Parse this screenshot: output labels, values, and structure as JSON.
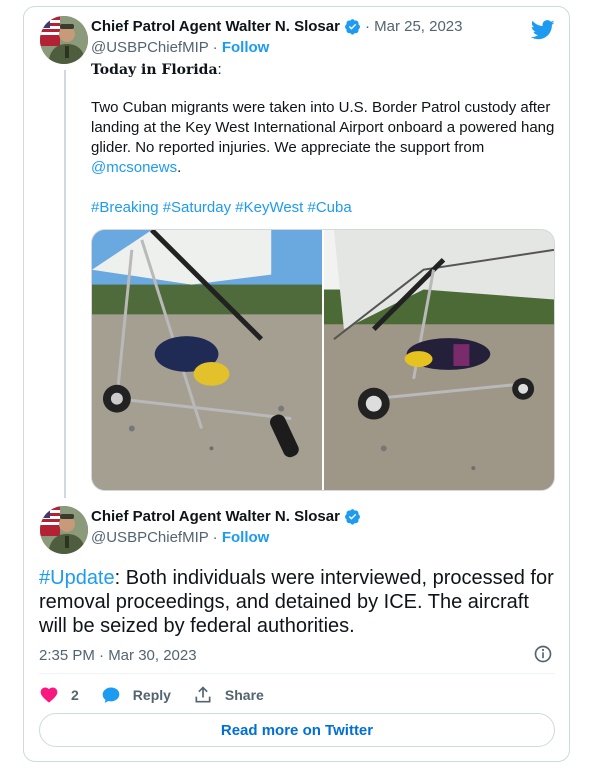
{
  "tweet1": {
    "author_name": "Chief Patrol Agent Walter N. Slosar",
    "handle": "@USBPChiefMIP",
    "separator": "·",
    "follow_label": "Follow",
    "date": "· Mar 25, 2023",
    "heading": "Today in Florida",
    "heading_suffix": ":",
    "body": "Two Cuban migrants were taken into U.S. Border Patrol custody after landing at the Key West International Airport onboard a powered hang glider. No reported injuries. We appreciate the support from ",
    "mention": "@mcsonews",
    "body_end": ".",
    "hashtags": "#Breaking #Saturday #KeyWest #Cuba"
  },
  "tweet2": {
    "author_name": "Chief Patrol Agent Walter N. Slosar",
    "handle": "@USBPChiefMIP",
    "separator": "·",
    "follow_label": "Follow",
    "hashtag": "#Update",
    "body": ": Both individuals were interviewed, processed for removal proceedings, and detained by ICE. The aircraft will be seized by federal authorities.",
    "timestamp": "2:35 PM · Mar 30, 2023"
  },
  "actions": {
    "like_count": "2",
    "reply_label": "Reply",
    "share_label": "Share"
  },
  "read_more_label": "Read more on Twitter",
  "colors": {
    "accent": "#1d9bf0",
    "like": "#f91880",
    "text": "#0f1419",
    "muted": "#536471",
    "border": "#cfd9de"
  },
  "icons": [
    "verified-badge-icon",
    "twitter-bird-icon",
    "info-icon",
    "heart-icon",
    "reply-icon",
    "share-icon"
  ]
}
